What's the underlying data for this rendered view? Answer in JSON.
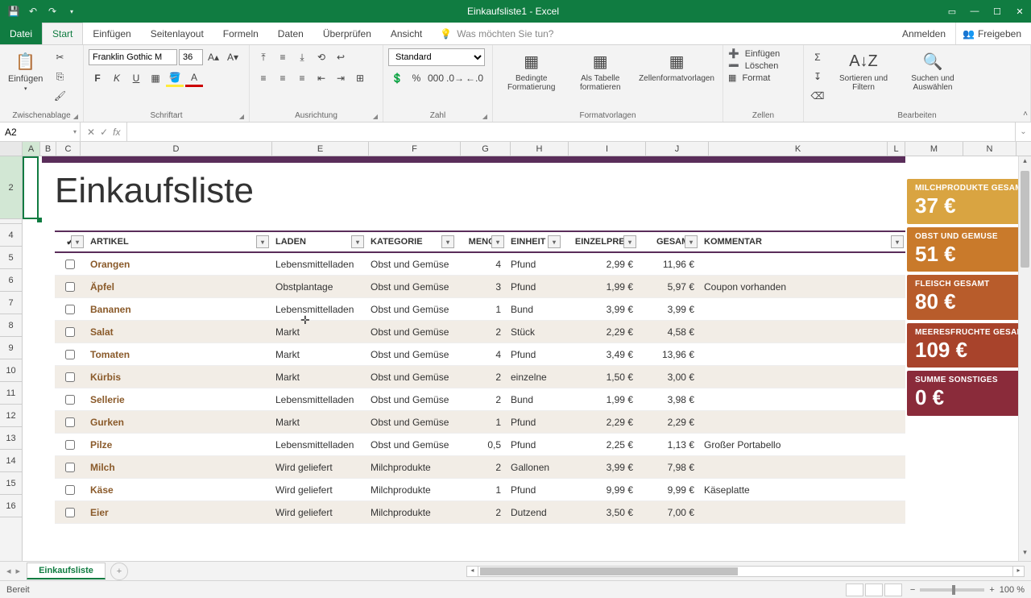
{
  "app": {
    "title": "Einkaufsliste1 - Excel"
  },
  "tabs": {
    "file": "Datei",
    "list": [
      "Start",
      "Einfügen",
      "Seitenlayout",
      "Formeln",
      "Daten",
      "Überprüfen",
      "Ansicht"
    ],
    "active": "Start",
    "tellme_placeholder": "Was möchten Sie tun?",
    "signin": "Anmelden",
    "share": "Freigeben"
  },
  "ribbon": {
    "clipboard": {
      "paste": "Einfügen",
      "label": "Zwischenablage"
    },
    "font": {
      "name": "Franklin Gothic M",
      "size": "36",
      "label": "Schriftart"
    },
    "align": {
      "label": "Ausrichtung"
    },
    "number": {
      "format": "Standard",
      "label": "Zahl"
    },
    "styles": {
      "cond": "Bedingte Formatierung",
      "astable": "Als Tabelle formatieren",
      "cellstyles": "Zellenformatvorlagen",
      "label": "Formatvorlagen"
    },
    "cells": {
      "insert": "Einfügen",
      "delete": "Löschen",
      "format": "Format",
      "label": "Zellen"
    },
    "editing": {
      "sort": "Sortieren und Filtern",
      "find": "Suchen und Auswählen",
      "label": "Bearbeiten"
    }
  },
  "namebox": "A2",
  "sheet": {
    "tab": "Einkaufsliste",
    "status": "Bereit",
    "zoom": "100 %"
  },
  "columns": [
    "A",
    "B",
    "C",
    "D",
    "E",
    "F",
    "G",
    "H",
    "I",
    "J",
    "K",
    "L",
    "M",
    "N"
  ],
  "rowNumbers": [
    "2",
    "4",
    "5",
    "6",
    "7",
    "8",
    "9",
    "10",
    "11",
    "12",
    "13",
    "14",
    "15",
    "16"
  ],
  "title": "Einkaufsliste",
  "headers": {
    "artikel": "ARTIKEL",
    "laden": "LADEN",
    "kategorie": "KATEGORIE",
    "menge": "MENGE",
    "einheit": "EINHEIT",
    "preis": "EINZELPREIS",
    "gesamt": "GESAMT",
    "kommentar": "KOMMENTAR"
  },
  "rows": [
    {
      "artikel": "Orangen",
      "laden": "Lebensmittelladen",
      "kat": "Obst und Gemüse",
      "menge": "4",
      "einheit": "Pfund",
      "preis": "2,99 €",
      "gesamt": "11,96 €",
      "kom": ""
    },
    {
      "artikel": "Äpfel",
      "laden": "Obstplantage",
      "kat": "Obst und Gemüse",
      "menge": "3",
      "einheit": "Pfund",
      "preis": "1,99 €",
      "gesamt": "5,97 €",
      "kom": "Coupon vorhanden"
    },
    {
      "artikel": "Bananen",
      "laden": "Lebensmittelladen",
      "kat": "Obst und Gemüse",
      "menge": "1",
      "einheit": "Bund",
      "preis": "3,99 €",
      "gesamt": "3,99 €",
      "kom": ""
    },
    {
      "artikel": "Salat",
      "laden": "Markt",
      "kat": "Obst und Gemüse",
      "menge": "2",
      "einheit": "Stück",
      "preis": "2,29 €",
      "gesamt": "4,58 €",
      "kom": ""
    },
    {
      "artikel": "Tomaten",
      "laden": "Markt",
      "kat": "Obst und Gemüse",
      "menge": "4",
      "einheit": "Pfund",
      "preis": "3,49 €",
      "gesamt": "13,96 €",
      "kom": ""
    },
    {
      "artikel": "Kürbis",
      "laden": "Markt",
      "kat": "Obst und Gemüse",
      "menge": "2",
      "einheit": "einzelne",
      "preis": "1,50 €",
      "gesamt": "3,00 €",
      "kom": ""
    },
    {
      "artikel": "Sellerie",
      "laden": "Lebensmittelladen",
      "kat": "Obst und Gemüse",
      "menge": "2",
      "einheit": "Bund",
      "preis": "1,99 €",
      "gesamt": "3,98 €",
      "kom": ""
    },
    {
      "artikel": "Gurken",
      "laden": "Markt",
      "kat": "Obst und Gemüse",
      "menge": "1",
      "einheit": "Pfund",
      "preis": "2,29 €",
      "gesamt": "2,29 €",
      "kom": ""
    },
    {
      "artikel": "Pilze",
      "laden": "Lebensmittelladen",
      "kat": "Obst und Gemüse",
      "menge": "0,5",
      "einheit": "Pfund",
      "preis": "2,25 €",
      "gesamt": "1,13 €",
      "kom": "Großer Portabello"
    },
    {
      "artikel": "Milch",
      "laden": "Wird geliefert",
      "kat": "Milchprodukte",
      "menge": "2",
      "einheit": "Gallonen",
      "preis": "3,99 €",
      "gesamt": "7,98 €",
      "kom": ""
    },
    {
      "artikel": "Käse",
      "laden": "Wird geliefert",
      "kat": "Milchprodukte",
      "menge": "1",
      "einheit": "Pfund",
      "preis": "9,99 €",
      "gesamt": "9,99 €",
      "kom": "Käseplatte"
    },
    {
      "artikel": "Eier",
      "laden": "Wird geliefert",
      "kat": "Milchprodukte",
      "menge": "2",
      "einheit": "Dutzend",
      "preis": "3,50 €",
      "gesamt": "7,00 €",
      "kom": ""
    }
  ],
  "cards": [
    {
      "label": "MILCHPRODUKTE GESAMT",
      "value": "37 €",
      "color": "#d9a441"
    },
    {
      "label": "OBST UND GEMÜSE",
      "value": "51 €",
      "color": "#c97a2b"
    },
    {
      "label": "FLEISCH GESAMT",
      "value": "80 €",
      "color": "#b85c2b"
    },
    {
      "label": "MEERESFRÜCHTE GESAMT",
      "value": "109 €",
      "color": "#a8432b"
    },
    {
      "label": "SUMME SONSTIGES",
      "value": "0 €",
      "color": "#8a2b3a"
    }
  ]
}
